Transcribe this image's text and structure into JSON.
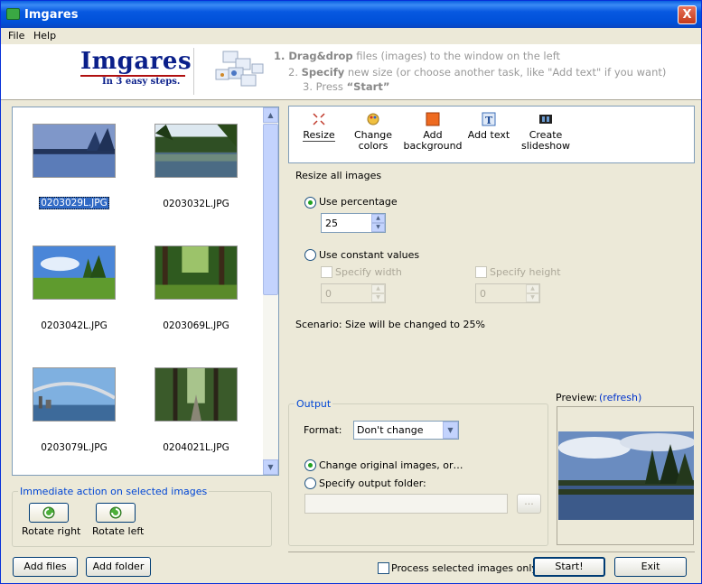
{
  "window": {
    "title": "Imgares",
    "close": "X"
  },
  "menu": [
    {
      "label": "File"
    },
    {
      "label": "Help"
    }
  ],
  "header": {
    "logo": "Imgares",
    "tagline": "In 3 easy steps.",
    "step1_bold": "1. Drag&drop",
    "step1_rest": " files (images)  to the window on the left",
    "step2_num": "2. ",
    "step2_bold": "Specify",
    "step2_rest": " new size (or choose another task, like \"Add text\" if you want)",
    "step3_num": "3. Press ",
    "step3_bold": "“Start”"
  },
  "gallery": {
    "images": [
      {
        "file": "0203029L.JPG",
        "selected": true
      },
      {
        "file": "0203032L.JPG"
      },
      {
        "file": "0203042L.JPG"
      },
      {
        "file": "0203069L.JPG"
      },
      {
        "file": "0203079L.JPG"
      },
      {
        "file": "0204021L.JPG"
      }
    ]
  },
  "immediate": {
    "title": "Immediate action on selected images",
    "rotate_right": "Rotate right",
    "rotate_left": "Rotate left"
  },
  "bottom": {
    "add_files": "Add files",
    "add_folder": "Add folder",
    "process_selected": "Process selected images only",
    "start": "Start!",
    "exit": "Exit"
  },
  "tools": [
    {
      "label": "Resize"
    },
    {
      "label1": "Change",
      "label2": "colors"
    },
    {
      "label1": "Add",
      "label2": "background"
    },
    {
      "label": "Add text"
    },
    {
      "label1": "Create",
      "label2": "slideshow"
    }
  ],
  "resize": {
    "heading": "Resize all images",
    "use_percentage": "Use percentage",
    "percentage_value": "25",
    "use_constant": "Use constant values",
    "specify_width": "Specify width",
    "width_value": "0",
    "specify_height": "Specify height",
    "height_value": "0",
    "scenario": "Scenario: Size will be changed to 25%"
  },
  "output": {
    "title": "Output",
    "format_label": "Format:",
    "format_value": "Don't change",
    "change_original": "Change original images, or…",
    "specify_folder": "Specify output folder:",
    "browse": "..."
  },
  "preview": {
    "label": "Preview:",
    "refresh": "(refresh)"
  }
}
